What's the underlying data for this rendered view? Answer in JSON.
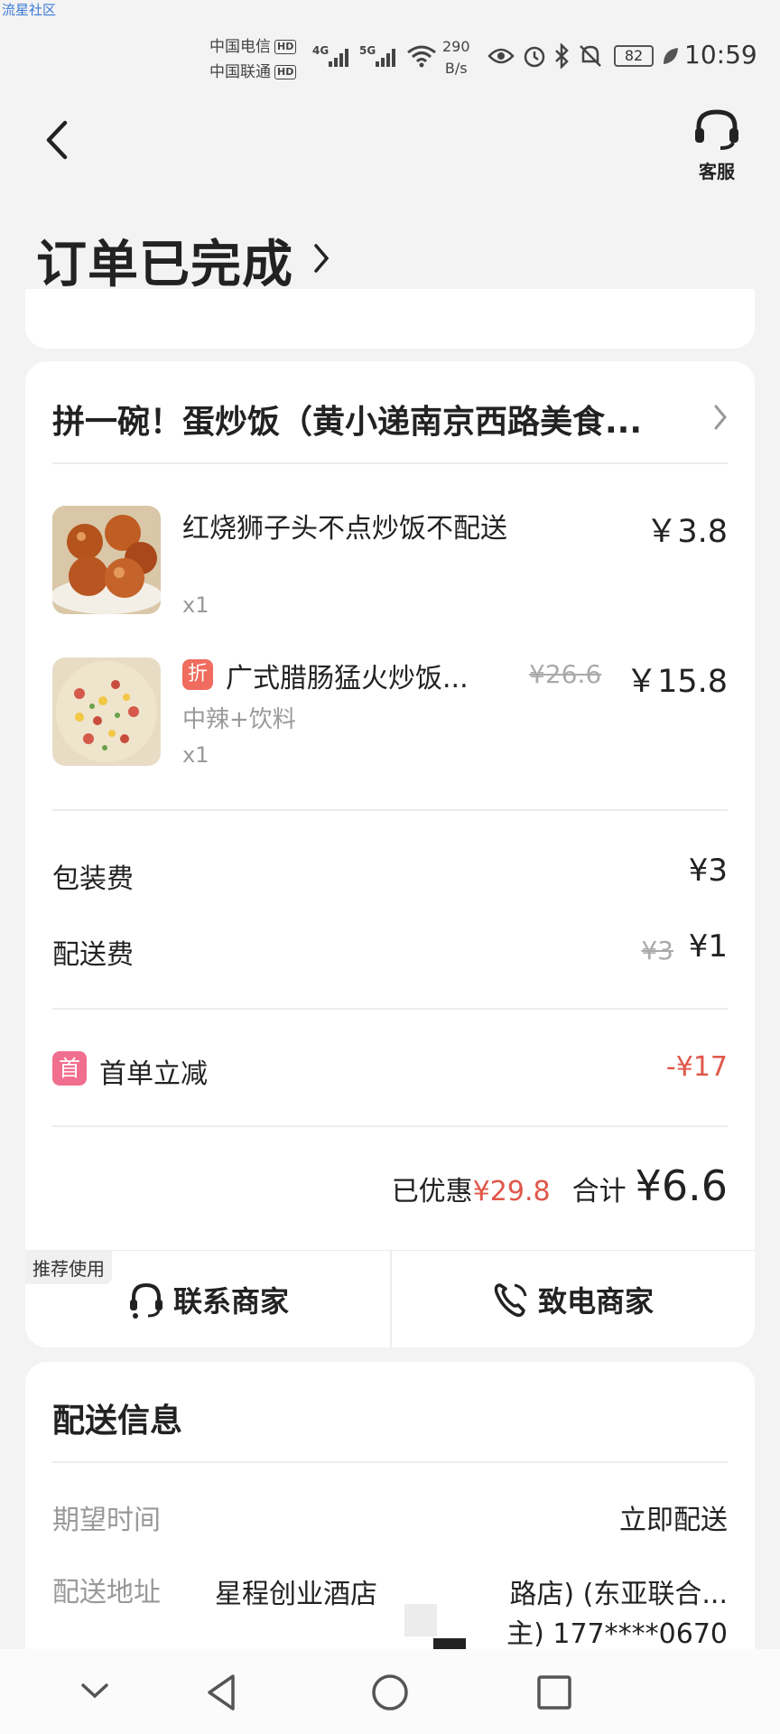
{
  "watermark": "流星社区",
  "status_bar": {
    "carrier_1": "中国电信",
    "carrier_2": "中国联通",
    "hd_badge": "HD",
    "network_1": "4G",
    "network_2": "5G",
    "net_speed_value": "290",
    "net_speed_unit": "B/s",
    "battery": "82",
    "time": "10:59"
  },
  "header": {
    "back_icon": "chevron-left-icon",
    "customer_service_label": "客服",
    "order_status": "订单已完成"
  },
  "order": {
    "shop_name": "拼一碗！蛋炒饭（黄小递南京西路美食...",
    "items": [
      {
        "name": "红烧狮子头不点炒饭不配送",
        "price": "￥3.8",
        "quantity": "x1"
      },
      {
        "badge": "折",
        "name": "广式腊肠猛火炒饭...",
        "original_price": "¥26.6",
        "price": "￥15.8",
        "spec": "中辣+饮料",
        "quantity": "x1"
      }
    ],
    "fees": {
      "packaging_label": "包装费",
      "packaging_value": "¥3",
      "delivery_label": "配送费",
      "delivery_original": "¥3",
      "delivery_value": "¥1"
    },
    "discount": {
      "badge": "首",
      "label": "首单立减",
      "value": "-¥17"
    },
    "totals": {
      "saved_label": "已优惠",
      "saved_value": "¥29.8",
      "total_label": "合计",
      "total_value": "¥6.6"
    },
    "actions": {
      "recommend_tag": "推荐使用",
      "contact_label": "联系商家",
      "call_label": "致电商家"
    }
  },
  "delivery": {
    "title": "配送信息",
    "expected_time_label": "期望时间",
    "expected_time_value": "立即配送",
    "address_label": "配送地址",
    "address_line1": "星程创业酒店",
    "address_line1_end": "路店) (东亚联合...",
    "address_line2_end": "主) 177****0670"
  },
  "colors": {
    "accent_red": "#e0574a",
    "badge_pink": "#f06f8f",
    "badge_orange": "#ef6c5e"
  }
}
